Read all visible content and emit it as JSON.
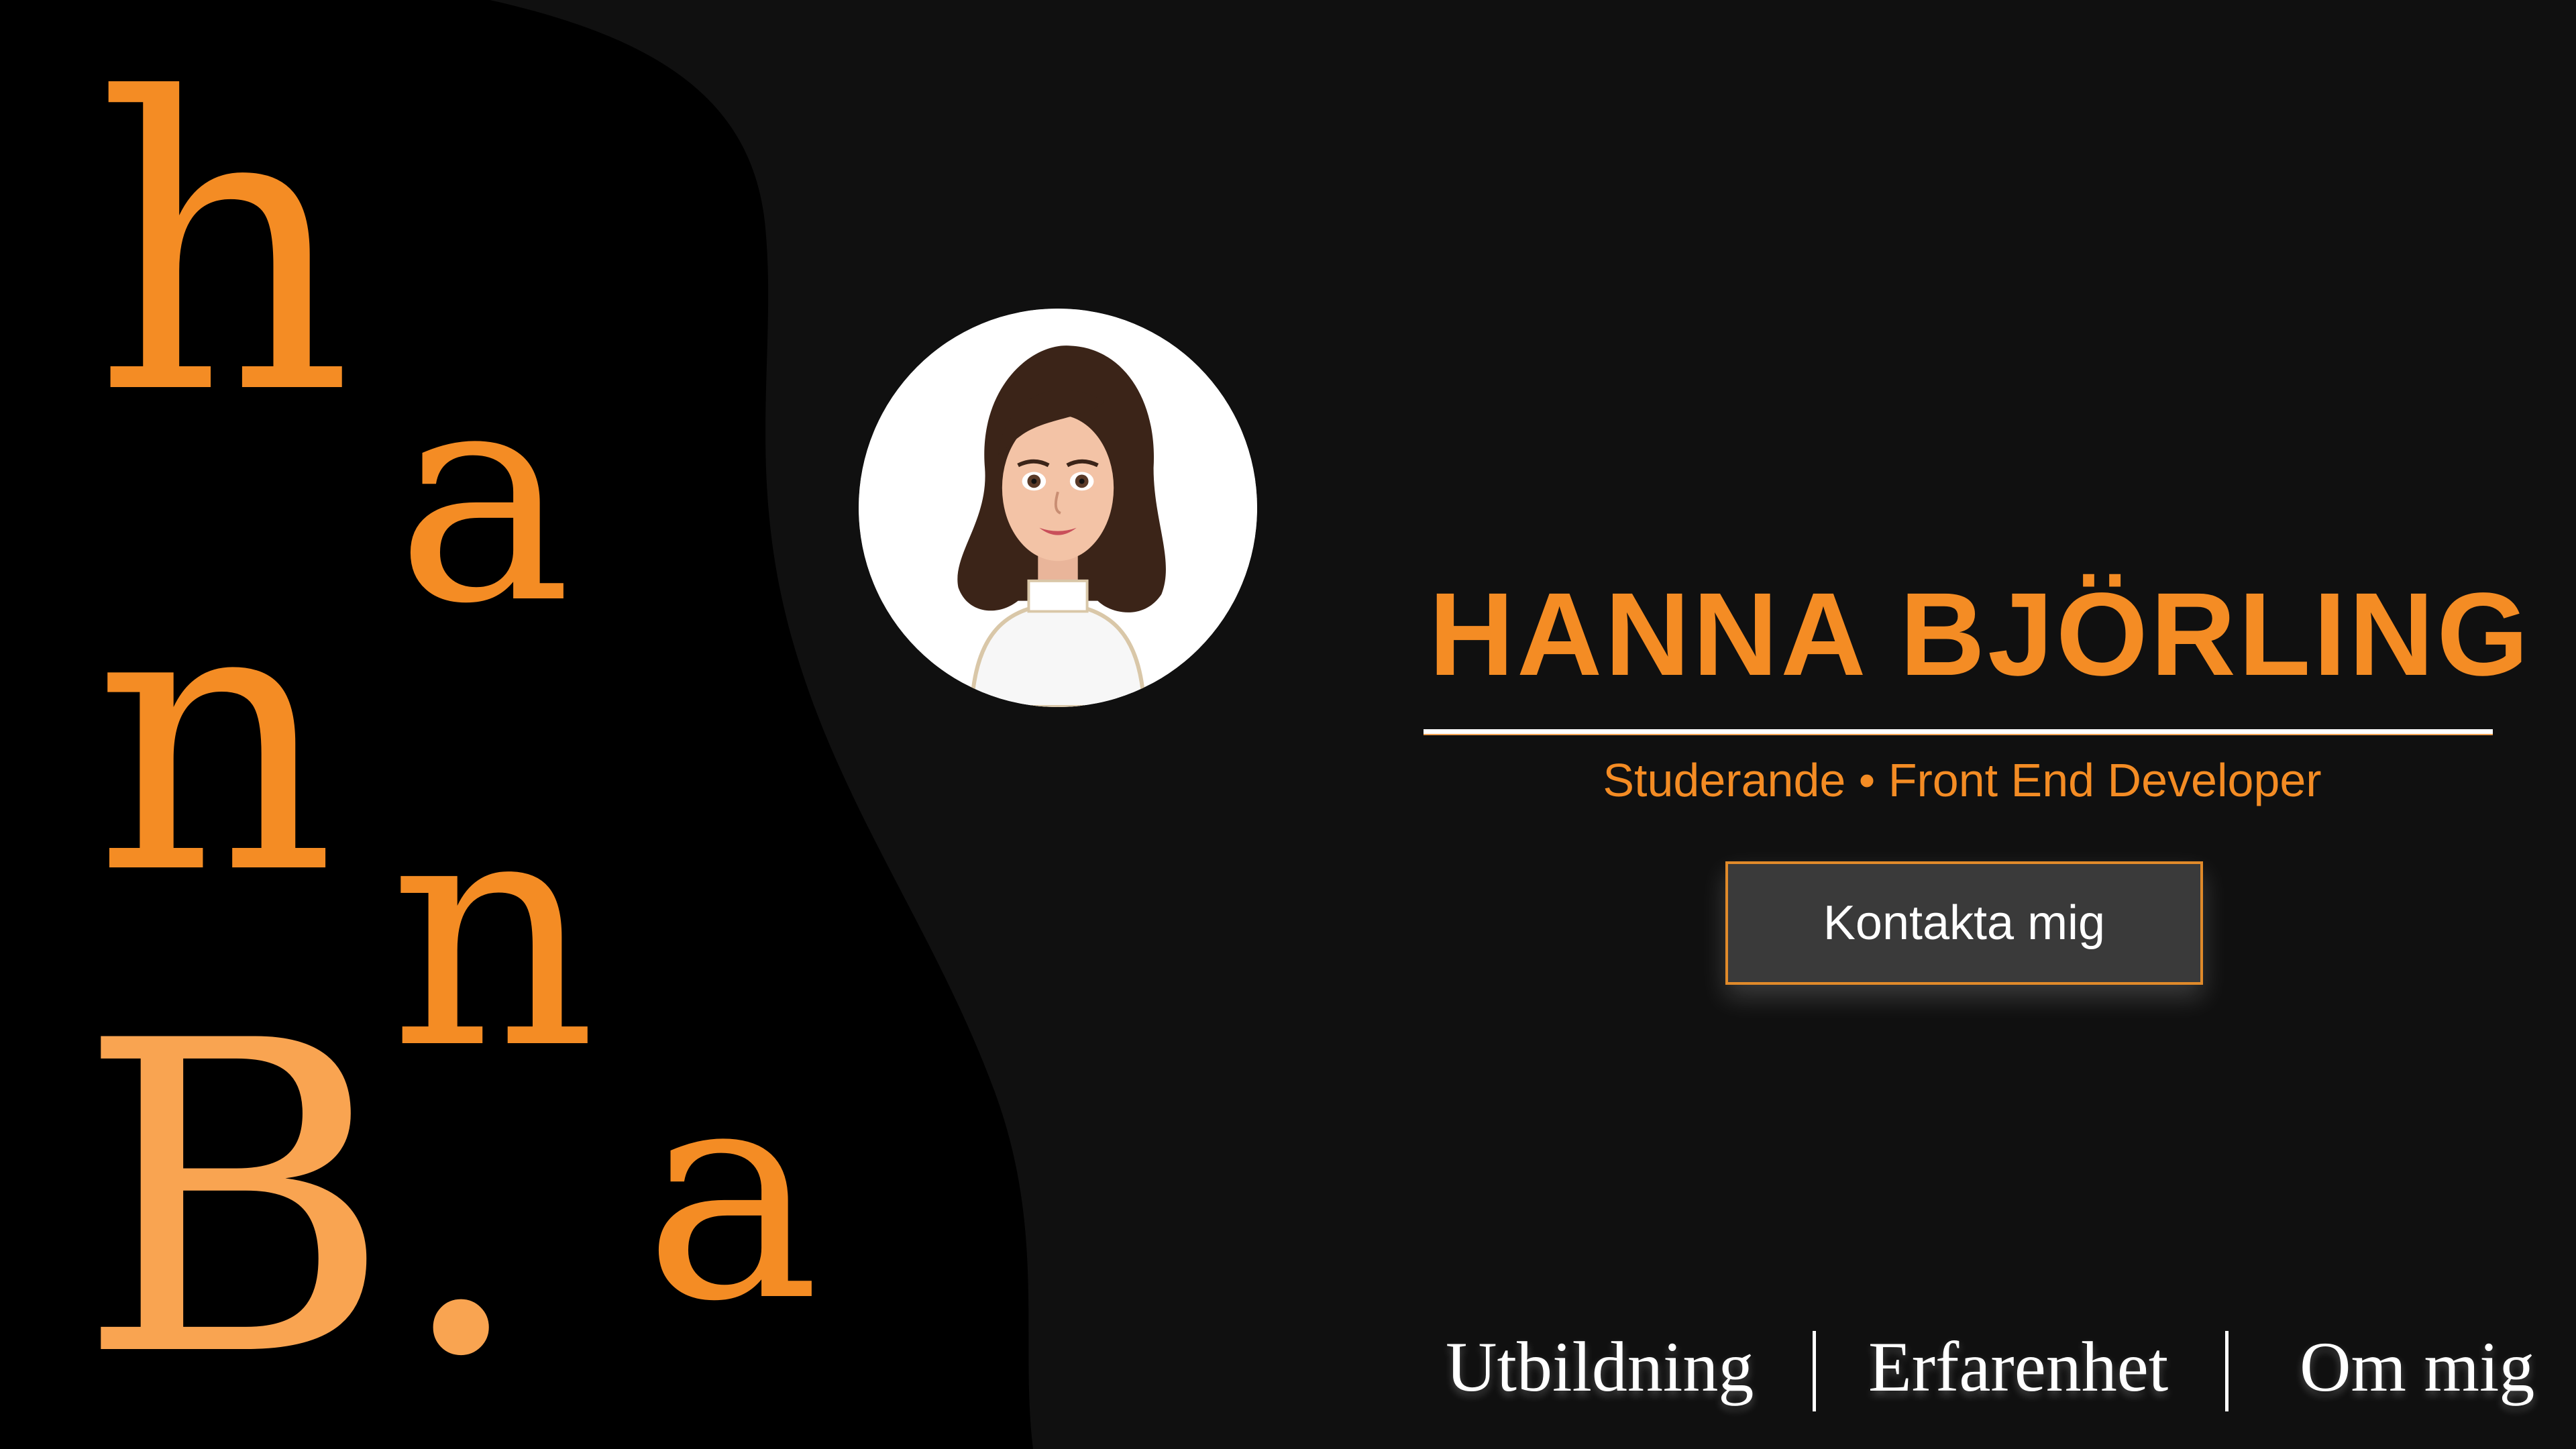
{
  "logo": {
    "letters": [
      "h",
      "a",
      "n",
      "n",
      "a"
    ],
    "initial": "B."
  },
  "avatar": {
    "icon": "avatar-illustration"
  },
  "header": {
    "name": "HANNA BJÖRLING",
    "subtitle": "Studerande • Front End Developer"
  },
  "cta": {
    "label": "Kontakta mig"
  },
  "nav": {
    "items": [
      {
        "label": "Utbildning"
      },
      {
        "label": "Erfarenhet"
      },
      {
        "label": "Om mig"
      }
    ]
  },
  "colors": {
    "accent": "#f48c24",
    "accent_light": "#f9a451",
    "background": "#101010",
    "blob": "#000000",
    "button_bg": "#3a3a3a"
  }
}
